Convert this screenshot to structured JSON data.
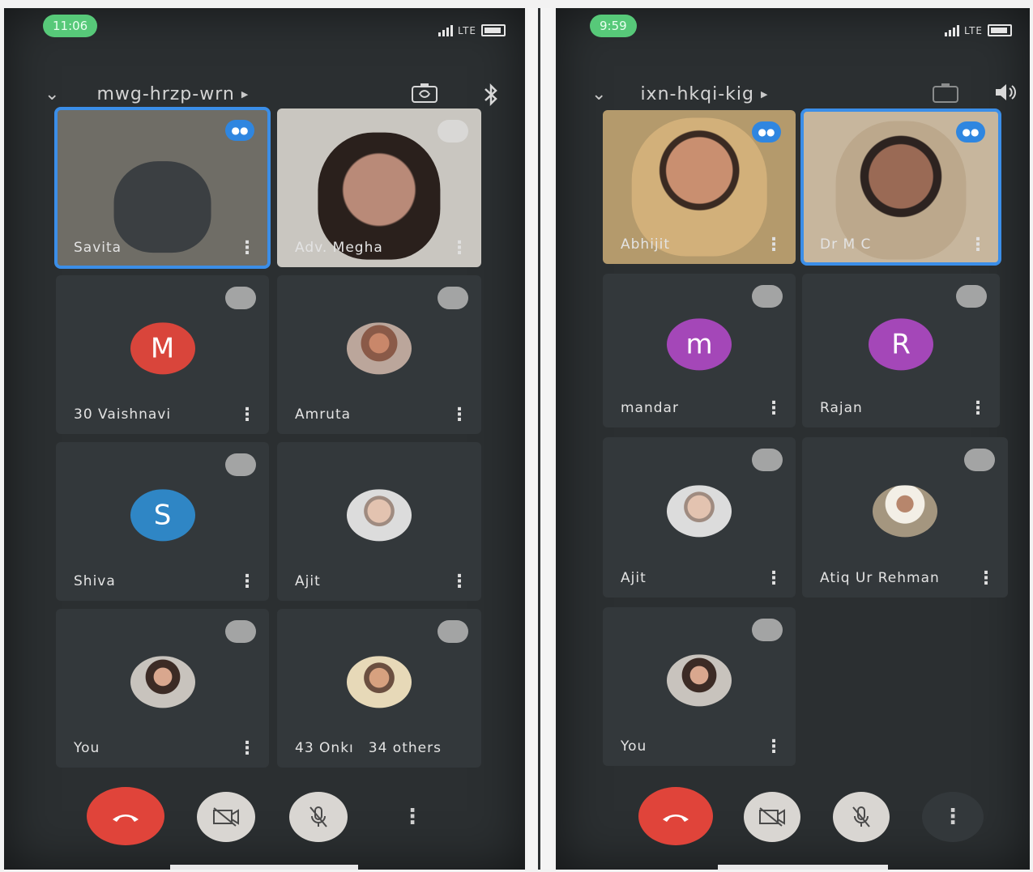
{
  "left_phone": {
    "status_time": "11:06",
    "network": "LTE",
    "meeting_code": "mwg-hrzp-wrn",
    "participants": [
      {
        "name": "Savita",
        "kind": "video",
        "speaking": true
      },
      {
        "name": "Adv. Megha",
        "kind": "video",
        "speaking": false
      },
      {
        "name": "30 Vaishnavi",
        "kind": "letter",
        "letter": "M",
        "color": "#d9453b"
      },
      {
        "name": "Amruta",
        "kind": "photo"
      },
      {
        "name": "Shiva",
        "kind": "letter",
        "letter": "S",
        "color": "#2f86c5"
      },
      {
        "name": "Ajit",
        "kind": "photo"
      },
      {
        "name": "You",
        "kind": "photo"
      },
      {
        "name": "43 Onkı",
        "extra": "34 others",
        "kind": "photo"
      }
    ]
  },
  "right_phone": {
    "status_time": "9:59",
    "network": "LTE",
    "meeting_code": "ixn-hkqi-kig",
    "participants": [
      {
        "name": "Abhijit",
        "kind": "video",
        "speaking": true
      },
      {
        "name": "Dr M C",
        "kind": "video",
        "speaking": true
      },
      {
        "name": "mandar",
        "kind": "letter",
        "letter": "m",
        "color": "#a447b8"
      },
      {
        "name": "Rajan",
        "kind": "letter",
        "letter": "R",
        "color": "#a447b8"
      },
      {
        "name": "Ajit",
        "kind": "photo"
      },
      {
        "name": "Atiq Ur Rehman",
        "kind": "photo"
      },
      {
        "name": "You",
        "kind": "photo"
      }
    ]
  },
  "icons": {
    "collapse": "chevron-down-icon",
    "camera_switch": "switch-camera-icon",
    "bluetooth": "bluetooth-icon",
    "speaker": "speaker-icon",
    "end_call": "end-call-icon",
    "camera_off": "camera-off-icon",
    "mic_off": "mic-off-icon",
    "more": "more-options-icon"
  },
  "colors": {
    "end_call": "#e0443a",
    "speaking": "#2f86e0",
    "status_pill": "#57c979"
  }
}
